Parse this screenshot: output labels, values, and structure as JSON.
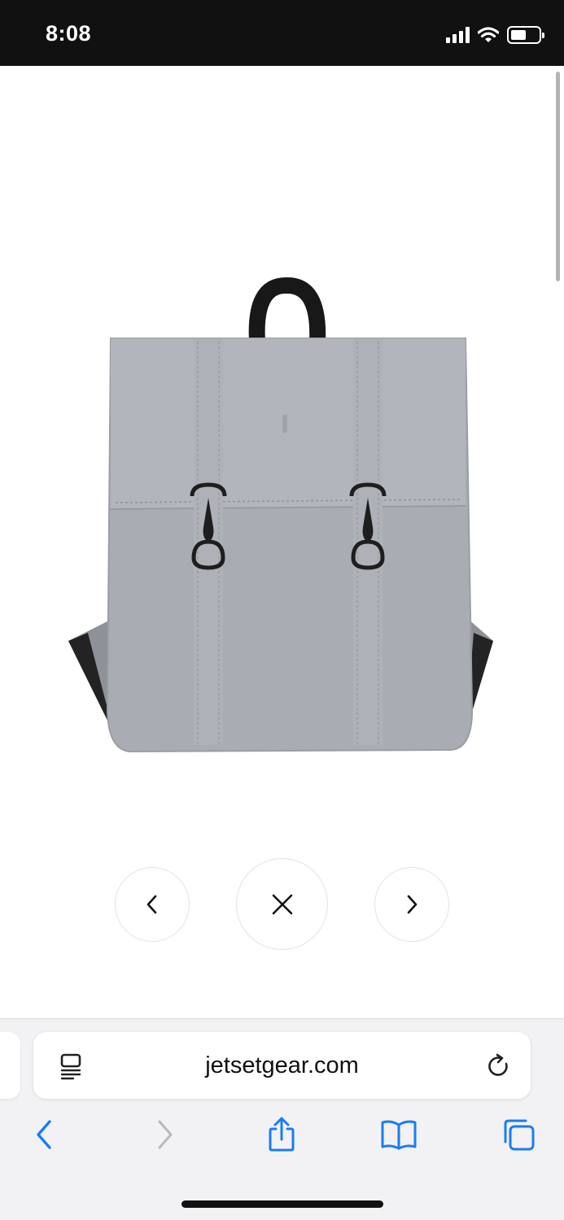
{
  "status_bar": {
    "time": "8:08",
    "icons": [
      "cellular-signal-icon",
      "wifi-icon",
      "battery-icon"
    ]
  },
  "product": {
    "image": "grey-backpack-image",
    "color": "#a9adb3"
  },
  "lightbox": {
    "controls": [
      "chevron-left-icon",
      "close-icon",
      "chevron-right-icon"
    ]
  },
  "browser": {
    "url": "jetsetgear.com",
    "toolbar": [
      "back-icon",
      "forward-icon",
      "share-icon",
      "bookmarks-icon",
      "tabs-icon"
    ],
    "accent": "#1a7cf5"
  }
}
